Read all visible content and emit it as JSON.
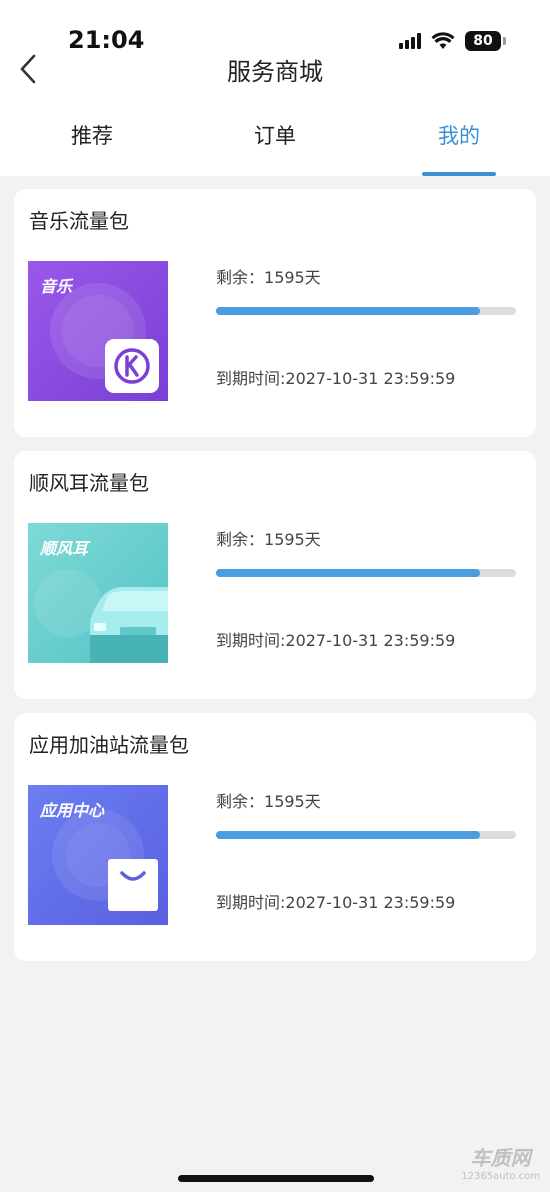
{
  "status_bar": {
    "time": "21:04",
    "battery": "80"
  },
  "header": {
    "title": "服务商城"
  },
  "tabs": [
    {
      "label": "推荐",
      "active": false
    },
    {
      "label": "订单",
      "active": false
    },
    {
      "label": "我的",
      "active": true
    }
  ],
  "accent_color": "#3d8fd6",
  "packages": [
    {
      "title": "音乐流量包",
      "thumb_label": "音乐",
      "thumb_icon": "k-music-icon",
      "remain_label": "剩余：",
      "remain_value": "1595天",
      "progress": 0.88,
      "expire": "到期时间:2027-10-31 23:59:59"
    },
    {
      "title": "顺风耳流量包",
      "thumb_label": "顺风耳",
      "thumb_icon": "car-icon",
      "remain_label": "剩余：",
      "remain_value": "1595天",
      "progress": 0.88,
      "expire": "到期时间:2027-10-31 23:59:59"
    },
    {
      "title": "应用加油站流量包",
      "thumb_label": "应用中心",
      "thumb_icon": "shopping-bag-icon",
      "remain_label": "剩余：",
      "remain_value": "1595天",
      "progress": 0.88,
      "expire": "到期时间:2027-10-31 23:59:59"
    }
  ],
  "watermark": "www.12365auto.com",
  "corner_logo": {
    "cn": "车质网",
    "en": "12365auto.com"
  }
}
